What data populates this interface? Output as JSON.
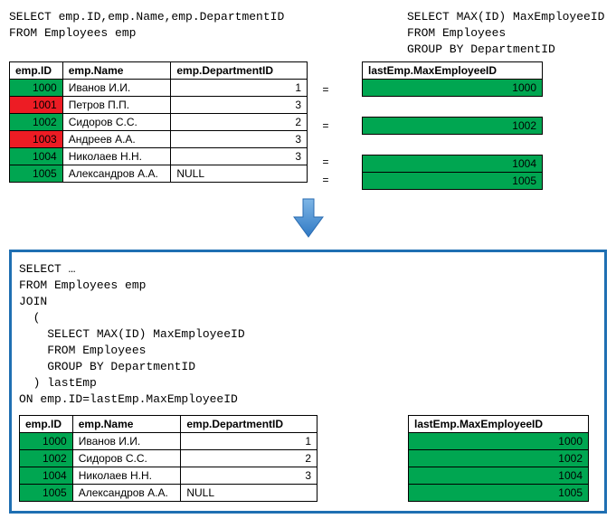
{
  "top_left_sql_line1": "SELECT emp.ID,emp.Name,emp.DepartmentID",
  "top_left_sql_line2": "FROM Employees emp",
  "top_right_sql_line1": "SELECT MAX(ID) MaxEmployeeID",
  "top_right_sql_line2": "FROM Employees",
  "top_right_sql_line3": "GROUP BY DepartmentID",
  "headers": {
    "empId": "emp.ID",
    "empName": "emp.Name",
    "empDept": "emp.DepartmentID",
    "maxEmp": "lastEmp.MaxEmployeeID"
  },
  "emp_rows": [
    {
      "id": "1000",
      "name": "Иванов И.И.",
      "dept": "1",
      "color": "green",
      "eq": "=",
      "max": "1000"
    },
    {
      "id": "1001",
      "name": "Петров П.П.",
      "dept": "3",
      "color": "red",
      "eq": "",
      "max": ""
    },
    {
      "id": "1002",
      "name": "Сидоров С.С.",
      "dept": "2",
      "color": "green",
      "eq": "=",
      "max": "1002"
    },
    {
      "id": "1003",
      "name": "Андреев А.А.",
      "dept": "3",
      "color": "red",
      "eq": "",
      "max": ""
    },
    {
      "id": "1004",
      "name": "Николаев Н.Н.",
      "dept": "3",
      "color": "green",
      "eq": "=",
      "max": "1004"
    },
    {
      "id": "1005",
      "name": "Александров А.А.",
      "dept": "NULL",
      "color": "green",
      "eq": "=",
      "max": "1005"
    }
  ],
  "result_sql": "SELECT …\nFROM Employees emp\nJOIN\n  (\n    SELECT MAX(ID) MaxEmployeeID\n    FROM Employees\n    GROUP BY DepartmentID\n  ) lastEmp\nON emp.ID=lastEmp.MaxEmployeeID",
  "result_rows": [
    {
      "id": "1000",
      "name": "Иванов И.И.",
      "dept": "1",
      "max": "1000"
    },
    {
      "id": "1002",
      "name": "Сидоров С.С.",
      "dept": "2",
      "max": "1002"
    },
    {
      "id": "1004",
      "name": "Николаев Н.Н.",
      "dept": "3",
      "max": "1004"
    },
    {
      "id": "1005",
      "name": "Александров А.А.",
      "dept": "NULL",
      "max": "1005"
    }
  ],
  "chart_data": {
    "type": "table",
    "title": "SQL JOIN with subquery for MAX(ID) per DepartmentID",
    "left_table": {
      "columns": [
        "emp.ID",
        "emp.Name",
        "emp.DepartmentID"
      ],
      "rows": [
        [
          1000,
          "Иванов И.И.",
          1
        ],
        [
          1001,
          "Петров П.П.",
          3
        ],
        [
          1002,
          "Сидоров С.С.",
          2
        ],
        [
          1003,
          "Андреев А.А.",
          3
        ],
        [
          1004,
          "Николаев Н.Н.",
          3
        ],
        [
          1005,
          "Александров А.А.",
          null
        ]
      ]
    },
    "right_table": {
      "columns": [
        "lastEmp.MaxEmployeeID"
      ],
      "rows": [
        [
          1000
        ],
        [
          1002
        ],
        [
          1004
        ],
        [
          1005
        ]
      ]
    },
    "join_result": {
      "columns": [
        "emp.ID",
        "emp.Name",
        "emp.DepartmentID",
        "lastEmp.MaxEmployeeID"
      ],
      "rows": [
        [
          1000,
          "Иванов И.И.",
          1,
          1000
        ],
        [
          1002,
          "Сидоров С.С.",
          2,
          1002
        ],
        [
          1004,
          "Николаев Н.Н.",
          3,
          1004
        ],
        [
          1005,
          "Александров А.А.",
          null,
          1005
        ]
      ]
    }
  }
}
